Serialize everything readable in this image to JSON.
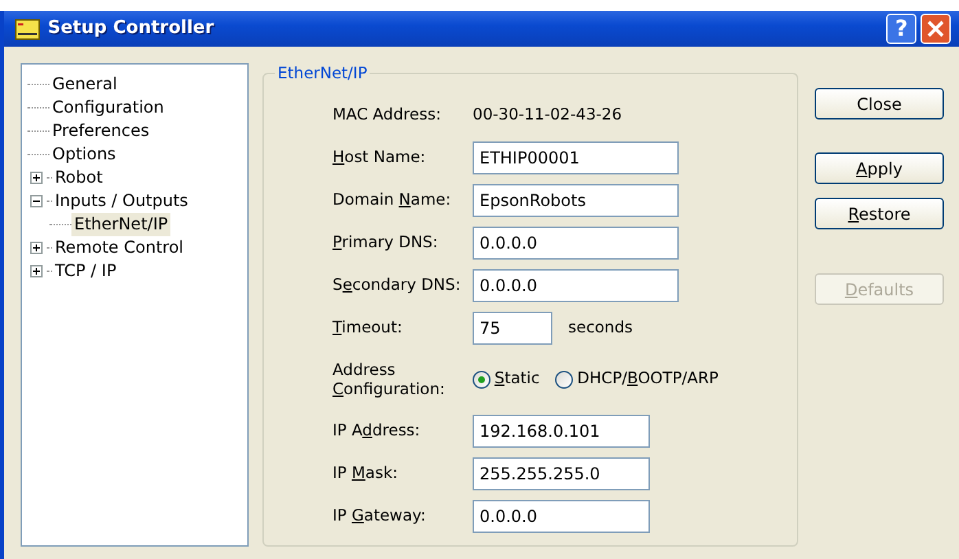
{
  "window": {
    "title": "Setup Controller",
    "help_glyph": "?"
  },
  "tree": [
    {
      "label": "General",
      "selected": false
    },
    {
      "label": "Configuration",
      "selected": false
    },
    {
      "label": "Preferences",
      "selected": false
    },
    {
      "label": "Options",
      "selected": false
    },
    {
      "label": "Robot",
      "selected": false,
      "expanded": false
    },
    {
      "label": "Inputs / Outputs",
      "selected": false,
      "expanded": true,
      "children": [
        {
          "label": "EtherNet/IP",
          "selected": true
        }
      ]
    },
    {
      "label": "Remote Control",
      "selected": false,
      "expanded": false
    },
    {
      "label": "TCP / IP",
      "selected": false,
      "expanded": false
    }
  ],
  "group": {
    "title": "EtherNet/IP",
    "rows": [
      {
        "kind": "static",
        "label": "MAC Address:",
        "value": "00-30-11-02-43-26"
      },
      {
        "kind": "long_field",
        "label": {
          "mnemonic": "H",
          "rest": "ost Name:"
        },
        "value": "ETHIP00001"
      },
      {
        "kind": "long_field",
        "label": {
          "pre": "Domain ",
          "mnemonic": "N",
          "rest": "ame:"
        },
        "value": "EpsonRobots"
      },
      {
        "kind": "long_field",
        "label": {
          "mnemonic": "P",
          "rest": "rimary DNS:"
        },
        "value": "0.0.0.0"
      },
      {
        "kind": "long_field",
        "label": {
          "pre": "S",
          "mnemonic": "e",
          "rest": "condary DNS:"
        },
        "value": "0.0.0.0"
      },
      {
        "kind": "short_field",
        "label": {
          "mnemonic": "T",
          "rest": "imeout:"
        },
        "value": "75",
        "suffix": "seconds"
      },
      {
        "kind": "radio",
        "label_top": "Address",
        "label": {
          "mnemonic": "C",
          "rest": "onfiguration:"
        },
        "options": [
          {
            "label": {
              "mnemonic": "S",
              "rest": "tatic"
            },
            "selected": true
          },
          {
            "label": {
              "pre": "DHCP/",
              "mnemonic": "B",
              "rest": "OOTP/ARP"
            },
            "selected": false
          }
        ]
      },
      {
        "kind": "medium_field",
        "label": {
          "pre": "IP A",
          "mnemonic": "d",
          "rest": "dress:"
        },
        "value": "192.168.0.101"
      },
      {
        "kind": "medium_field",
        "label": {
          "pre": "IP ",
          "mnemonic": "M",
          "rest": "ask:"
        },
        "value": "255.255.255.0"
      },
      {
        "kind": "medium_field",
        "label": {
          "pre": "IP ",
          "mnemonic": "G",
          "rest": "ateway:"
        },
        "value": "0.0.0.0"
      }
    ]
  },
  "buttons": [
    {
      "label": "Close",
      "disabled": false
    },
    {
      "label": {
        "mnemonic": "A",
        "rest": "pply"
      },
      "disabled": false
    },
    {
      "label": {
        "mnemonic": "R",
        "rest": "estore"
      },
      "disabled": false
    },
    {
      "label": {
        "mnemonic": "D",
        "rest": "efaults"
      },
      "disabled": true
    }
  ]
}
